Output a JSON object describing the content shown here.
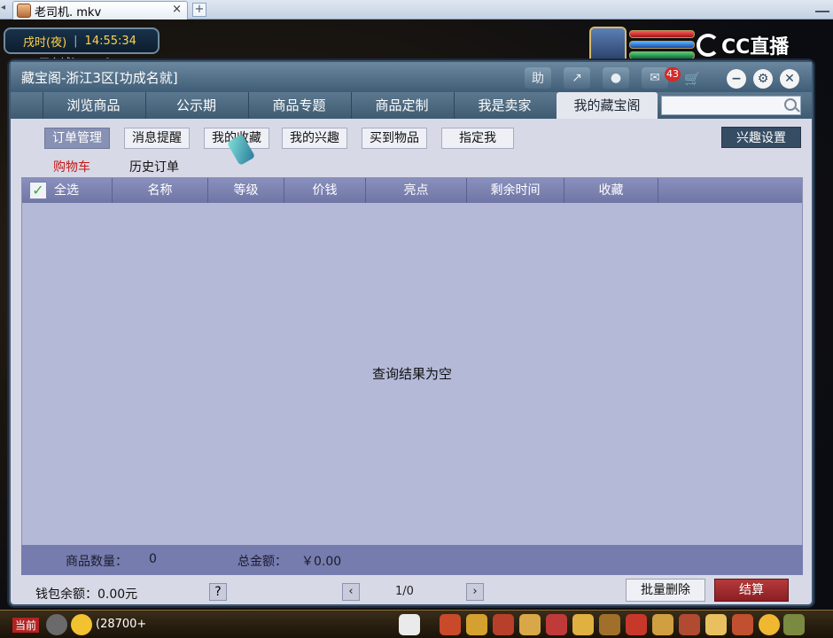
{
  "browser": {
    "tab_title": "老司机. mkv",
    "tab_close": "×",
    "tab_add": "+"
  },
  "hud": {
    "time_of_day": "戌时(夜)",
    "clock": "14:55:34",
    "location": "天多城[23,12]",
    "brand": "CC直播"
  },
  "dialog": {
    "title": "藏宝阁-浙江3区[功成名就]",
    "help_label": "助",
    "message_count": "43",
    "nav_tabs": [
      "浏览商品",
      "公示期",
      "商品专题",
      "商品定制",
      "我是卖家",
      "我的藏宝阁"
    ],
    "active_nav_tab": "我的藏宝阁",
    "search_placeholder": "",
    "sub_tabs": [
      "订单管理",
      "消息提醒",
      "我的收藏",
      "我的兴趣",
      "买到物品",
      "指定我"
    ],
    "active_sub_tab": "订单管理",
    "interest_settings": "兴趣设置",
    "order_links": {
      "cart": "购物车",
      "history": "历史订单"
    },
    "table": {
      "select_all": "全选",
      "checkmark": "✓",
      "columns": [
        "名称",
        "等级",
        "价钱",
        "亮点",
        "剩余时间",
        "收藏"
      ],
      "empty_message": "查询结果为空"
    },
    "summary": {
      "count_label": "商品数量：",
      "count_value": "0",
      "total_label": "总金额：",
      "total_value": "￥0.00"
    },
    "footer": {
      "wallet_label": "钱包余额：",
      "wallet_value": "0.00元",
      "page_prev": "‹",
      "page_next": "›",
      "page_help": "?",
      "page_status": "1/0",
      "batch_delete": "批量删除",
      "checkout": "结算"
    }
  },
  "bottom_bar": {
    "current_label": "当前",
    "count": "(28700+"
  }
}
